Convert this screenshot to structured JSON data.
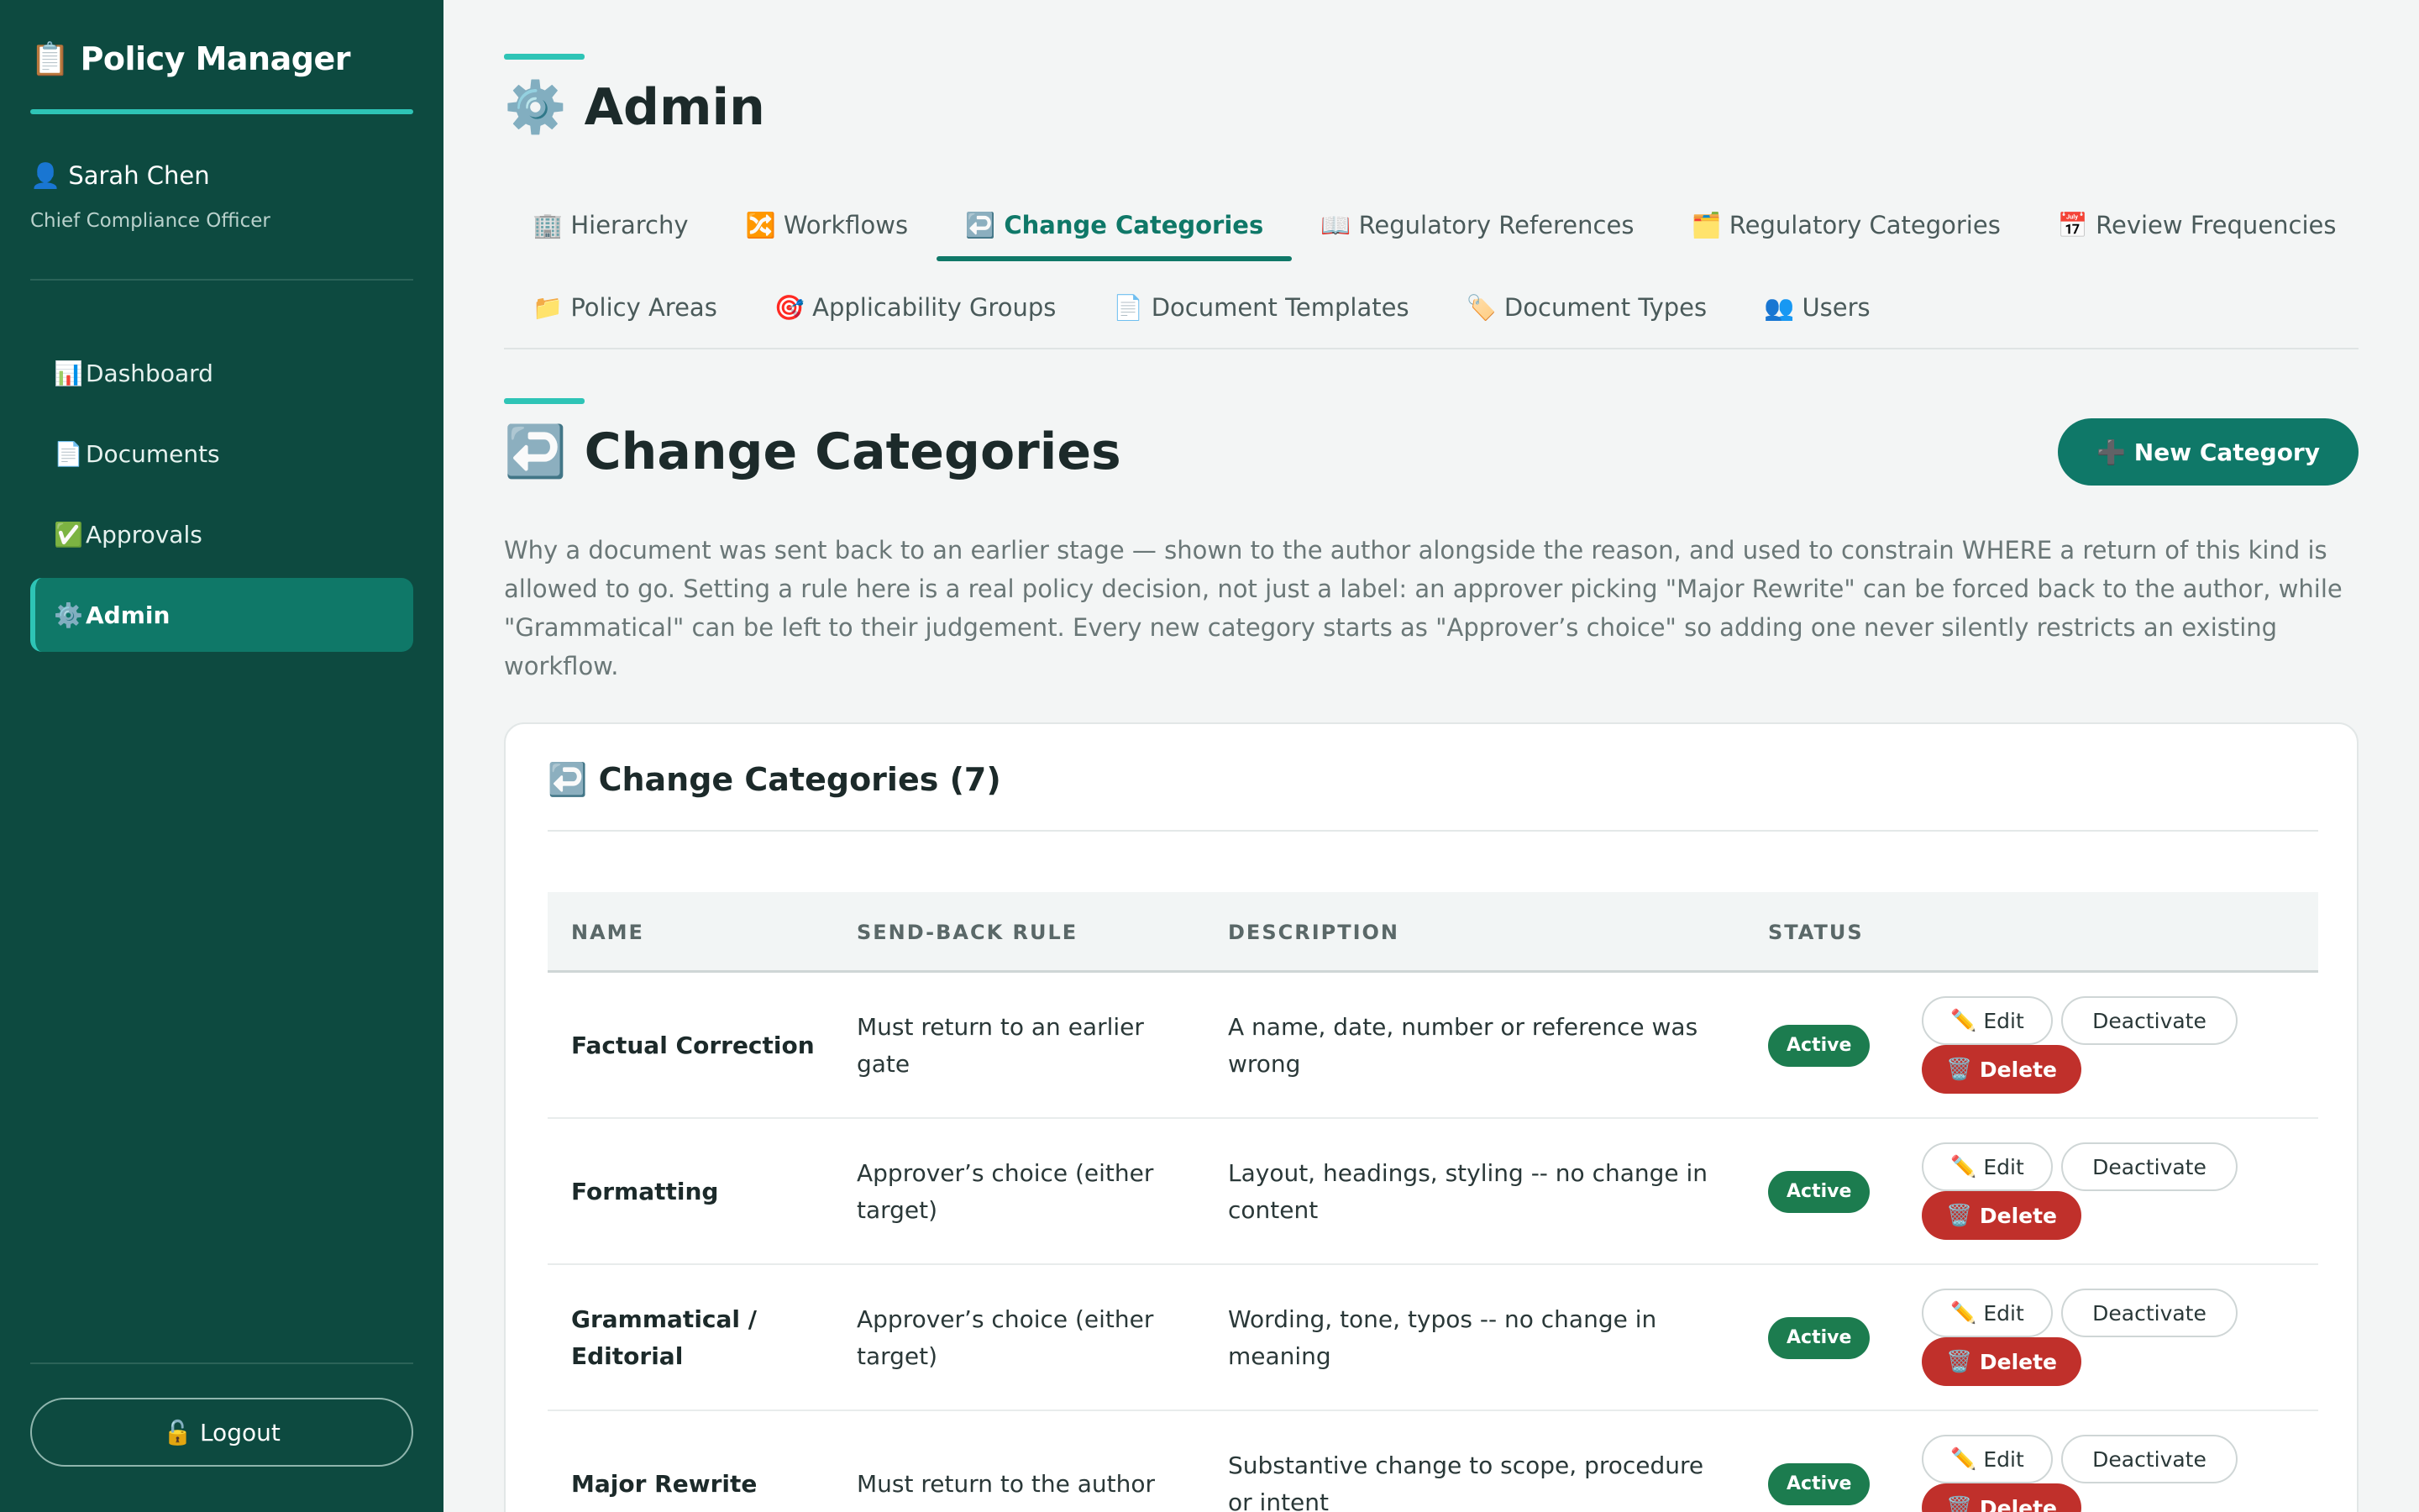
{
  "sidebar": {
    "brand_icon": "📋",
    "brand": "Policy Manager",
    "user_icon": "👤",
    "user_name": "Sarah Chen",
    "user_role": "Chief Compliance Officer",
    "nav": [
      {
        "icon": "📊",
        "label": "Dashboard",
        "active": false
      },
      {
        "icon": "📄",
        "label": "Documents",
        "active": false
      },
      {
        "icon": "✅",
        "label": "Approvals",
        "active": false
      },
      {
        "icon": "⚙️",
        "label": "Admin",
        "active": true
      }
    ],
    "logout_icon": "🔓",
    "logout": "Logout"
  },
  "page": {
    "title_icon": "⚙️",
    "title": "Admin"
  },
  "tabs_row1": [
    {
      "icon": "🏢",
      "label": "Hierarchy",
      "active": false
    },
    {
      "icon": "🔀",
      "label": "Workflows",
      "active": false
    },
    {
      "icon": "↩️",
      "label": "Change Categories",
      "active": true
    },
    {
      "icon": "📖",
      "label": "Regulatory References",
      "active": false
    },
    {
      "icon": "🗂️",
      "label": "Regulatory Categories",
      "active": false
    },
    {
      "icon": "📅",
      "label": "Review Frequencies",
      "active": false
    }
  ],
  "tabs_row2": [
    {
      "icon": "📁",
      "label": "Policy Areas",
      "active": false
    },
    {
      "icon": "🎯",
      "label": "Applicability Groups",
      "active": false
    },
    {
      "icon": "📄",
      "label": "Document Templates",
      "active": false
    },
    {
      "icon": "🏷️",
      "label": "Document Types",
      "active": false
    },
    {
      "icon": "👥",
      "label": "Users",
      "active": false
    }
  ],
  "section": {
    "title_icon": "↩️",
    "title": "Change Categories",
    "new_button_icon": "➕",
    "new_button": "New Category",
    "intro": "Why a document was sent back to an earlier stage — shown to the author alongside the reason, and used to constrain WHERE a return of this kind is allowed to go. Setting a rule here is a real policy decision, not just a label: an approver picking \"Major Rewrite\" can be forced back to the author, while \"Grammatical\" can be left to their judgement. Every new category starts as \"Approver’s choice\" so adding one never silently restricts an existing workflow."
  },
  "card": {
    "title_icon": "↩️",
    "title": "Change Categories (7)"
  },
  "table": {
    "headers": [
      "NAME",
      "SEND-BACK RULE",
      "DESCRIPTION",
      "STATUS"
    ],
    "rows": [
      {
        "name": "Factual Correction",
        "rule": "Must return to an earlier gate",
        "description": "A name, date, number or reference was wrong",
        "status": "Active"
      },
      {
        "name": "Formatting",
        "rule": "Approver’s choice (either target)",
        "description": "Layout, headings, styling -- no change in content",
        "status": "Active"
      },
      {
        "name": "Grammatical / Editorial",
        "rule": "Approver’s choice (either target)",
        "description": "Wording, tone, typos -- no change in meaning",
        "status": "Active"
      },
      {
        "name": "Major Rewrite",
        "rule": "Must return to the author",
        "description": "Substantive change to scope, procedure or intent",
        "status": "Active"
      }
    ],
    "actions": {
      "edit_icon": "✏️",
      "edit": "Edit",
      "deactivate": "Deactivate",
      "delete_icon": "🗑️",
      "delete": "Delete"
    }
  },
  "colors": {
    "sidebar_bg": "#0d4a40",
    "accent": "#2ec4b6",
    "primary": "#0f7868",
    "active_badge": "#1c7c4f",
    "danger": "#c0302b"
  }
}
